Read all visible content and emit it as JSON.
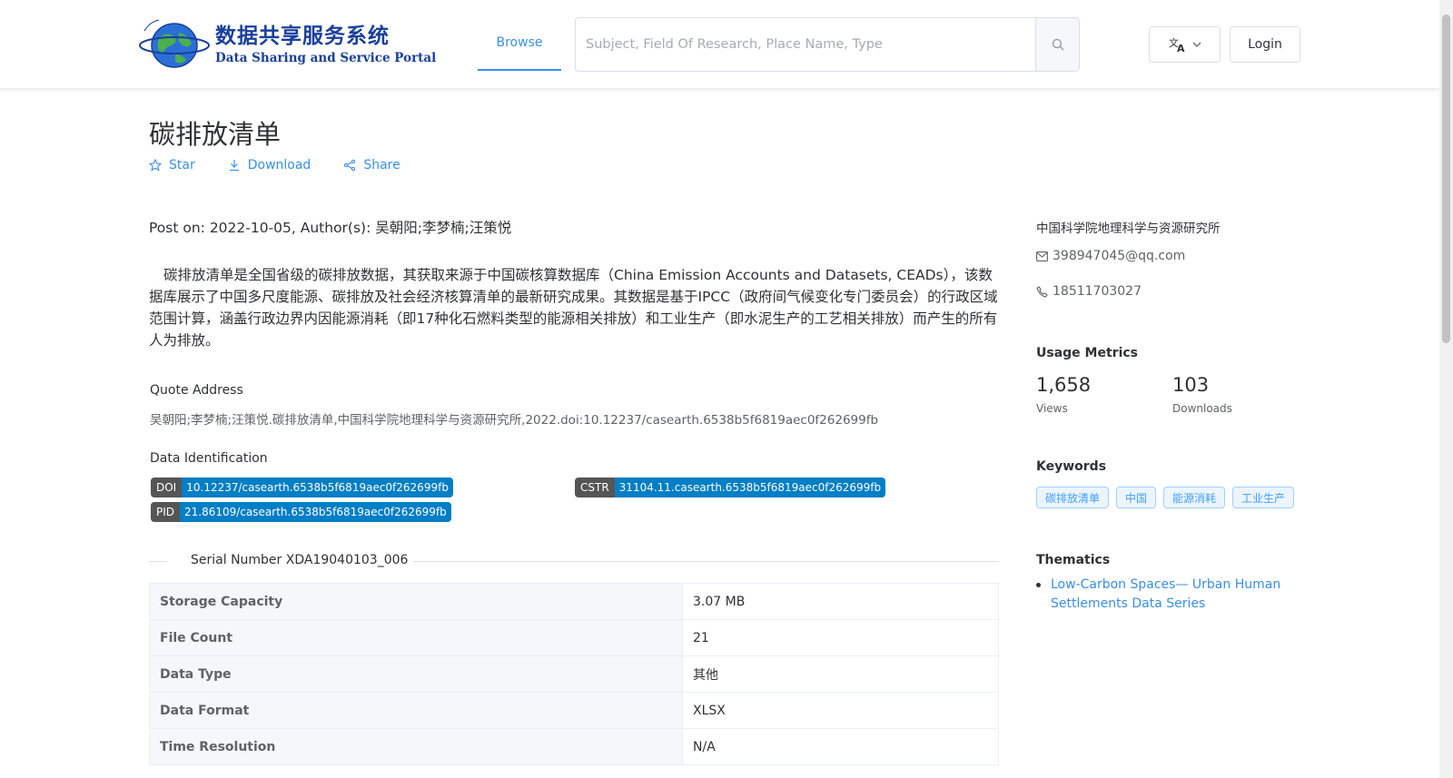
{
  "header": {
    "logo_cn": "数据共享服务系统",
    "logo_en": "Data Sharing and Service Portal",
    "nav_browse": "Browse",
    "search_placeholder": "Subject, Field Of Research, Place Name, Type",
    "login": "Login"
  },
  "dataset": {
    "title": "碳排放清单",
    "actions": {
      "star": "Star",
      "download": "Download",
      "share": "Share"
    },
    "post_meta": "Post on: 2022-10-05, Author(s): 吴朝阳;李梦楠;汪策悦",
    "description": "碳排放清单是全国省级的碳排放数据，其获取来源于中国碳核算数据库（China Emission Accounts and Datasets, CEADs），该数据库展示了中国多尺度能源、碳排放及社会经济核算清单的最新研究成果。其数据是基于IPCC（政府间气候变化专门委员会）的行政区域范围计算，涵盖行政边界内因能源消耗（即17种化石燃料类型的能源相关排放）和工业生产（即水泥生产的工艺相关排放）而产生的所有人为排放。",
    "quote_label": "Quote Address",
    "quote_text": "吴朝阳;李梦楠;汪策悦.碳排放清单,中国科学院地理科学与资源研究所,2022.doi:10.12237/casearth.6538b5f6819aec0f262699fb",
    "identification_label": "Data Identification",
    "identifiers": {
      "doi_key": "DOI",
      "doi": "10.12237/casearth.6538b5f6819aec0f262699fb",
      "cstr_key": "CSTR",
      "cstr": "31104.11.casearth.6538b5f6819aec0f262699fb",
      "pid_key": "PID",
      "pid": "21.86109/casearth.6538b5f6819aec0f262699fb"
    },
    "serial": "Serial Number XDA19040103_006",
    "info_table": [
      {
        "label": "Storage Capacity",
        "value": "3.07 MB"
      },
      {
        "label": "File Count",
        "value": "21"
      },
      {
        "label": "Data Type",
        "value": "其他"
      },
      {
        "label": "Data Format",
        "value": "XLSX"
      },
      {
        "label": "Time Resolution",
        "value": "N/A"
      }
    ]
  },
  "sidebar": {
    "organization": "中国科学院地理科学与资源研究所",
    "email": "398947045@qq.com",
    "phone": "18511703027",
    "usage_heading": "Usage Metrics",
    "views_value": "1,658",
    "views_label": "Views",
    "downloads_value": "103",
    "downloads_label": "Downloads",
    "keywords_heading": "Keywords",
    "keywords": [
      "碳排放清单",
      "中国",
      "能源消耗",
      "工业生产"
    ],
    "thematics_heading": "Thematics",
    "thematic_link": "Low-Carbon Spaces— Urban Human Settlements Data Series"
  },
  "colors": {
    "accent": "#3a8ee6",
    "badge_key": "#555555",
    "badge_value": "#007ec6",
    "logo_blue": "#1a3f9c"
  },
  "icons": [
    "globe-logo-icon",
    "search-icon",
    "translate-icon",
    "chevron-down-icon",
    "star-icon",
    "download-icon",
    "share-icon",
    "mail-icon",
    "phone-icon"
  ]
}
